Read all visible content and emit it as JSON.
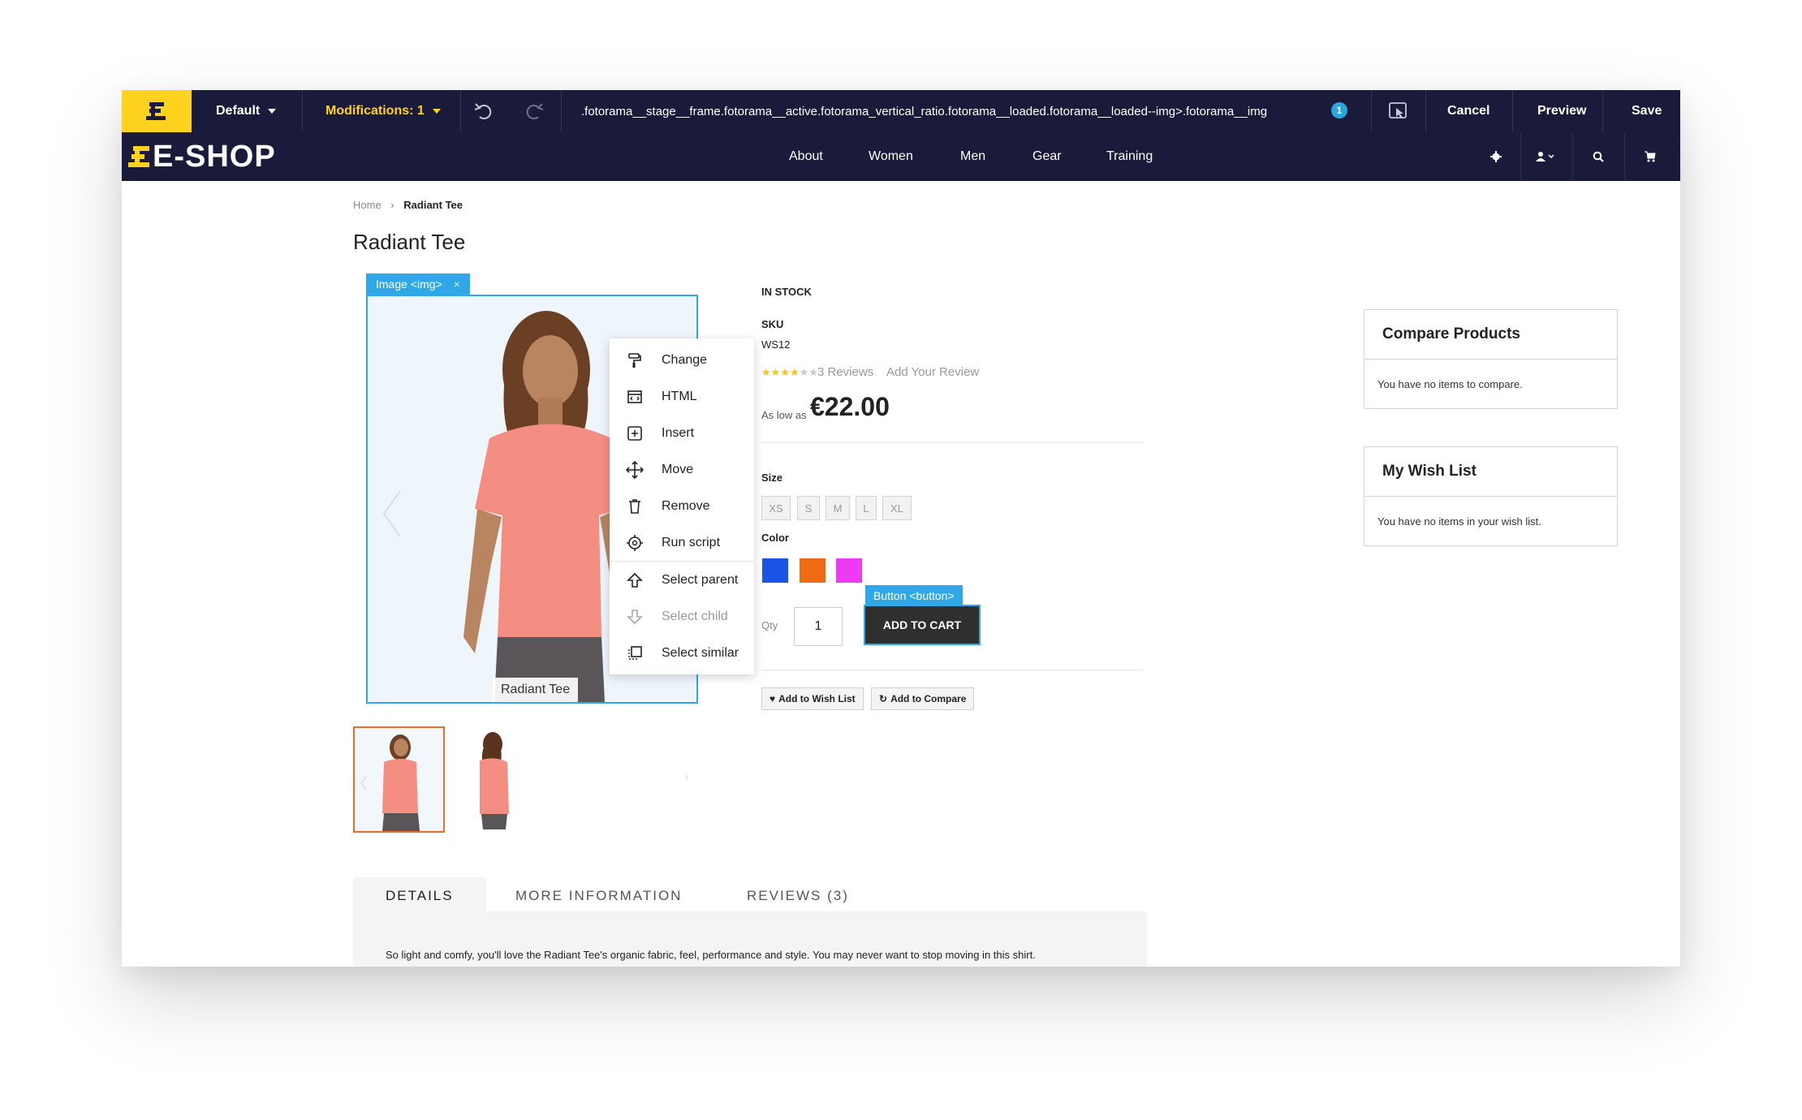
{
  "editor": {
    "layout_dropdown": "Default",
    "modifications": "Modifications: 1",
    "selector_path": ".fotorama__stage__frame.fotorama__active.fotorama_vertical_ratio.fotorama__loaded.fotorama__loaded--img>.fotorama__img",
    "badge_count": "1",
    "cancel": "Cancel",
    "preview": "Preview",
    "save": "Save",
    "accent_color": "#ffd21f",
    "bar_color": "#1a1a3a"
  },
  "shop": {
    "logo": "E-SHOP",
    "nav": [
      "About",
      "Women",
      "Men",
      "Gear",
      "Training"
    ]
  },
  "breadcrumb": {
    "home": "Home",
    "current": "Radiant Tee"
  },
  "product": {
    "title": "Radiant Tee",
    "image_label": "Image <img>",
    "image_caption": "Radiant Tee",
    "stock": "IN STOCK",
    "sku_label": "SKU",
    "sku": "WS12",
    "rating_stars": 4,
    "reviews": "3 Reviews",
    "add_review": "Add Your Review",
    "as_low_as": "As low as",
    "price": "€22.00",
    "size_label": "Size",
    "sizes": [
      "XS",
      "S",
      "M",
      "L",
      "XL"
    ],
    "color_label": "Color",
    "colors": [
      "#1a55e8",
      "#ef6a12",
      "#ee3af2"
    ],
    "qty_label": "Qty",
    "qty": "1",
    "button_label": "Button <button>",
    "add_to_cart": "ADD TO CART",
    "wish_list": "Add to Wish List",
    "compare": "Add to Compare"
  },
  "context_menu": [
    {
      "label": "Change",
      "icon": "paint-roller-icon",
      "enabled": true
    },
    {
      "label": "HTML",
      "icon": "code-window-icon",
      "enabled": true
    },
    {
      "label": "Insert",
      "icon": "plus-square-icon",
      "enabled": true
    },
    {
      "label": "Move",
      "icon": "move-arrows-icon",
      "enabled": true
    },
    {
      "label": "Remove",
      "icon": "trash-icon",
      "enabled": true
    },
    {
      "label": "Run script",
      "icon": "gear-script-icon",
      "enabled": true
    },
    {
      "label": "Select parent",
      "icon": "arrow-up-icon",
      "enabled": true
    },
    {
      "label": "Select child",
      "icon": "arrow-down-icon",
      "enabled": false
    },
    {
      "label": "Select similar",
      "icon": "select-similar-icon",
      "enabled": true
    }
  ],
  "sidebar": {
    "compare_title": "Compare Products",
    "compare_body": "You have no items to compare.",
    "wish_title": "My Wish List",
    "wish_body": "You have no items in your wish list."
  },
  "tabs": {
    "details": "DETAILS",
    "more_info": "MORE INFORMATION",
    "reviews": "REVIEWS (3)",
    "details_text": "So light and comfy, you'll love the Radiant Tee's organic fabric, feel, performance and style. You may never want to stop moving in this shirt."
  }
}
